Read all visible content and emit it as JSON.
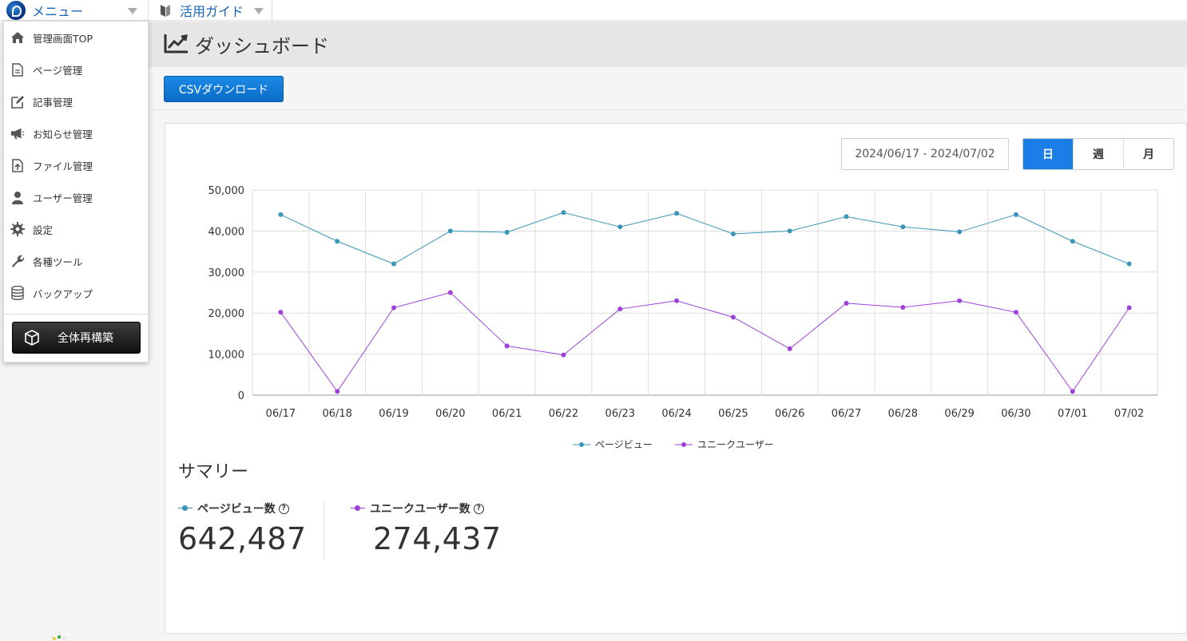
{
  "topbar": {
    "menu_label": "メニュー",
    "guide_label": "活用ガイド"
  },
  "dropdown": {
    "items": [
      {
        "label": "管理画面TOP",
        "icon": "home-icon"
      },
      {
        "label": "ページ管理",
        "icon": "page-icon"
      },
      {
        "label": "記事管理",
        "icon": "edit-icon"
      },
      {
        "label": "お知らせ管理",
        "icon": "megaphone-icon"
      },
      {
        "label": "ファイル管理",
        "icon": "file-upload-icon"
      },
      {
        "label": "ユーザー管理",
        "icon": "user-icon"
      },
      {
        "label": "設定",
        "icon": "gear-icon"
      },
      {
        "label": "各種ツール",
        "icon": "wrench-icon"
      },
      {
        "label": "バックアップ",
        "icon": "database-icon"
      }
    ],
    "rebuild_label": "全体再構築"
  },
  "header": {
    "title": "ダッシュボード"
  },
  "toolbar": {
    "csv_label": "CSVダウンロード"
  },
  "filters": {
    "date_range": "2024/06/17 - 2024/07/02",
    "periods": [
      "日",
      "週",
      "月"
    ],
    "active_period": "日"
  },
  "colors": {
    "pageviews": "#3a96b8",
    "unique_users": "#a040d8",
    "accent": "#1a7ee6"
  },
  "chart_data": {
    "type": "line",
    "categories": [
      "06/17",
      "06/18",
      "06/19",
      "06/20",
      "06/21",
      "06/22",
      "06/23",
      "06/24",
      "06/25",
      "06/26",
      "06/27",
      "06/28",
      "06/29",
      "06/30",
      "07/01",
      "07/02"
    ],
    "series": [
      {
        "name": "ページビュー",
        "values": [
          44000,
          37500,
          32000,
          40000,
          39700,
          44500,
          41000,
          44300,
          39300,
          40000,
          43500,
          41000,
          39800,
          44000,
          37500,
          32000
        ]
      },
      {
        "name": "ユニークユーザー",
        "values": [
          20200,
          900,
          21300,
          25000,
          12000,
          9800,
          21000,
          23000,
          19000,
          11300,
          22400,
          21400,
          23000,
          20200,
          900,
          21300
        ]
      }
    ],
    "yticks": [
      "50,000",
      "40,000",
      "30,000",
      "20,000",
      "10,000",
      "0"
    ],
    "ylim": [
      0,
      50000
    ],
    "grid": true,
    "legend": "bottom-center"
  },
  "summary": {
    "title": "サマリー",
    "metrics": [
      {
        "label": "ページビュー数",
        "value": "642,487"
      },
      {
        "label": "ユニークユーザー数",
        "value": "274,437"
      }
    ]
  }
}
